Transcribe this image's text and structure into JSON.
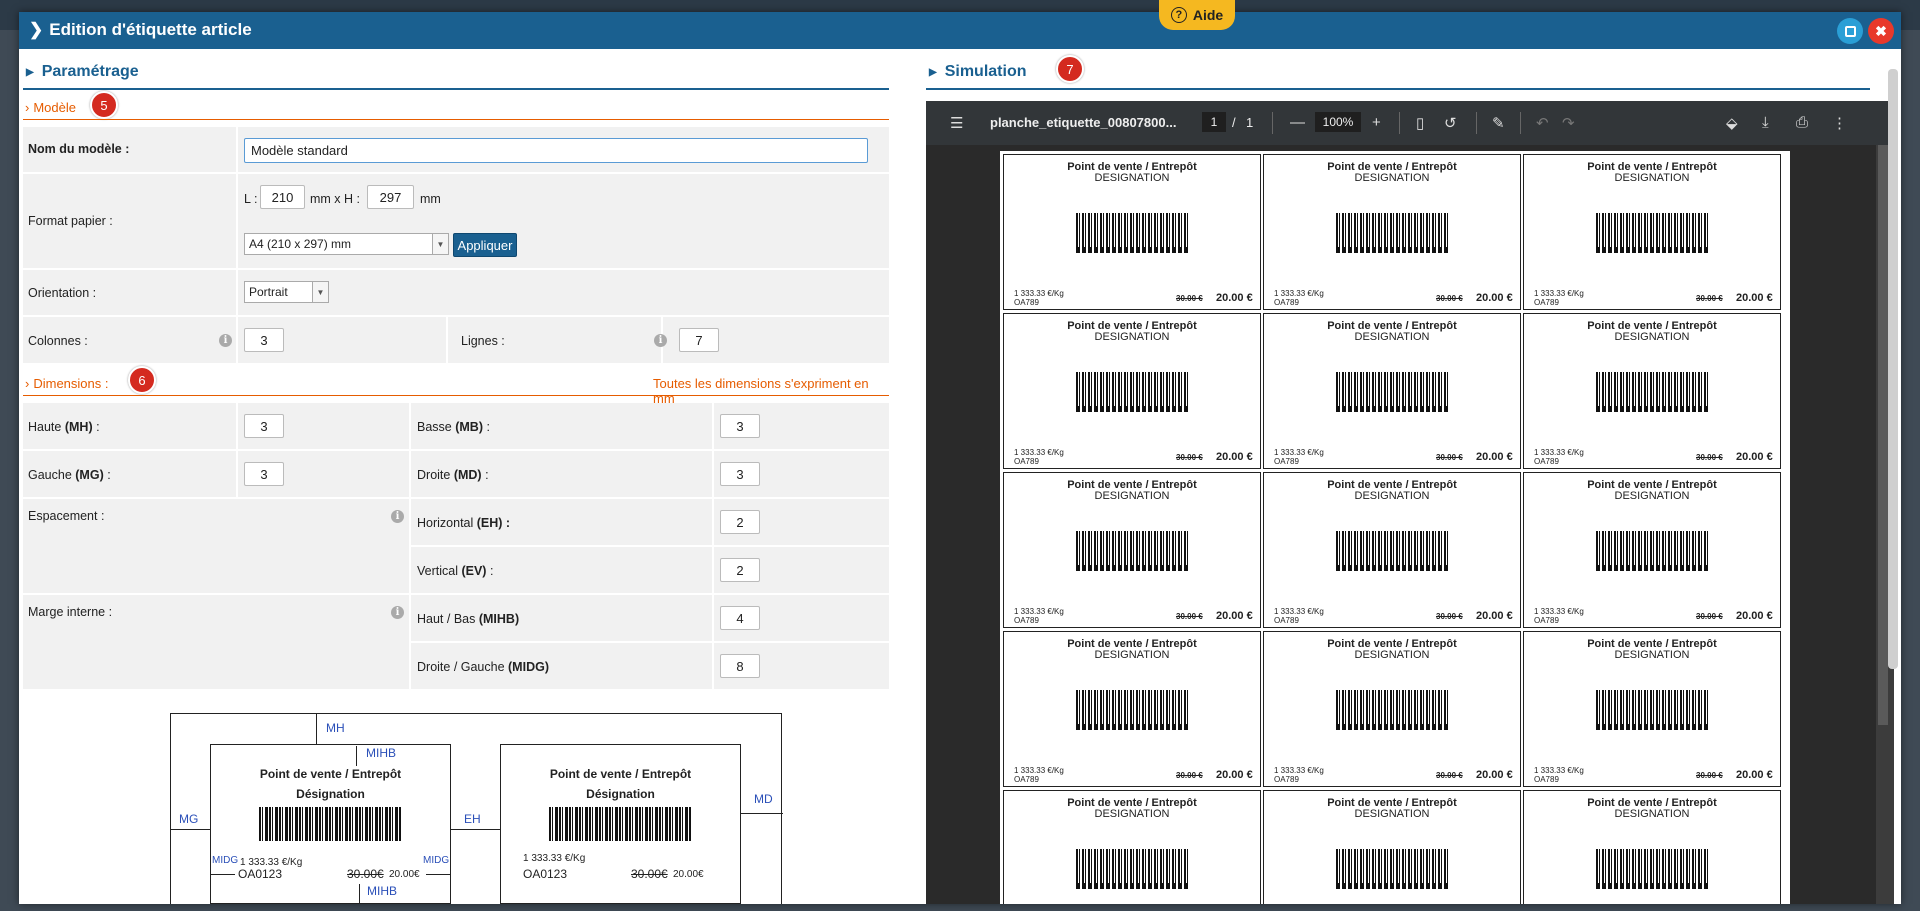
{
  "modal": {
    "title": "Edition d'étiquette article",
    "help_label": "Aide"
  },
  "left": {
    "section_title": "Paramétrage",
    "modele": {
      "title": "Modèle",
      "badge": "5",
      "name_label": "Nom du modèle :",
      "name_value": "Modèle standard",
      "format_label": "Format papier :",
      "l_label": "L :",
      "l_value": "210",
      "mm_x_h": "mm x H :",
      "h_value": "297",
      "mm": "mm",
      "format_selected": "A4 (210 x 297) mm",
      "apply_label": "Appliquer",
      "orientation_label": "Orientation :",
      "orientation_selected": "Portrait",
      "colonnes_label": "Colonnes  :",
      "colonnes_value": "3",
      "lignes_label": "Lignes  :",
      "lignes_value": "7"
    },
    "dimensions": {
      "title": "Dimensions :",
      "badge": "6",
      "note": "Toutes les dimensions s'expriment en mm",
      "haute_label": "Haute ",
      "haute_code": "(MH)",
      "haute_value": "3",
      "basse_label": "Basse ",
      "basse_code": "(MB)",
      "basse_value": "3",
      "gauche_label": "Gauche ",
      "gauche_code": "(MG)",
      "gauche_value": "3",
      "droite_label": "Droite ",
      "droite_code": "(MD)",
      "droite_value": "3",
      "espacement_label": "Espacement :",
      "horizontal_label": "Horizontal ",
      "horizontal_code": "(EH)",
      "horizontal_value": "2",
      "vertical_label": "Vertical ",
      "vertical_code": "(EV)",
      "vertical_value": "2",
      "marge_label": "Marge interne  :",
      "hautbas_label": "Haut / Bas ",
      "hautbas_code": "(MIHB)",
      "hautbas_value": "4",
      "droitegauche_label": "Droite / Gauche ",
      "droitegauche_code": "(MIDG)",
      "droitegauche_value": "8"
    },
    "diagram": {
      "mh": "MH",
      "mihb": "MIHB",
      "mg": "MG",
      "eh": "EH",
      "md": "MD",
      "midg": "MIDG",
      "label_title": "Point de vente / Entrepôt",
      "label_designation": "Désignation",
      "price_per_kg": "1 333.33 €/Kg",
      "ref": "OA0123",
      "old_price": "30.00€",
      "new_price": "20.00€"
    }
  },
  "right": {
    "section_title": "Simulation",
    "badge": "7",
    "pdf": {
      "filename": "planche_etiquette_00807800...",
      "page_current": "1",
      "page_sep": "/",
      "page_total": "1",
      "zoom": "100%",
      "label_title": "Point de vente / Entrepôt",
      "label_designation": "DESIGNATION",
      "price_per_kg": "1 333.33 €/Kg",
      "ref": "OA789",
      "old_price": "30.00 €",
      "new_price": "20.00 €"
    }
  }
}
